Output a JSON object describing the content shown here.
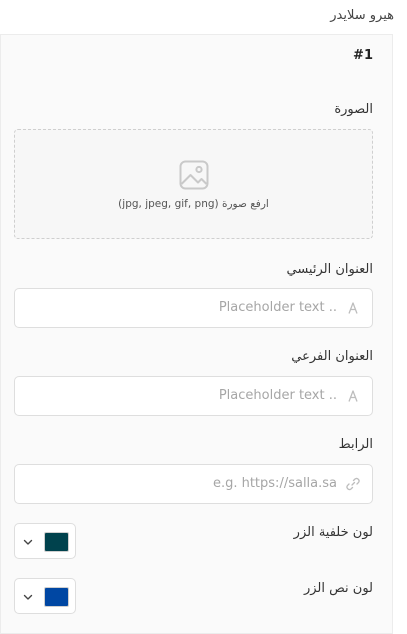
{
  "header": {
    "title": "هيرو سلايدر"
  },
  "item": {
    "number": "#1",
    "image_label": "الصورة",
    "upload_text": "ارفع صورة (jpg, jpeg, gif, png)",
    "main_title_label": "العنوان الرئيسي",
    "main_title_placeholder": "Placeholder text ..",
    "subtitle_label": "العنوان الفرعي",
    "subtitle_placeholder": "Placeholder text ..",
    "link_label": "الرابط",
    "link_placeholder": "e.g. https://salla.sa",
    "button_bg_label": "لون خلفية الزر",
    "button_bg_color": "#00424d",
    "button_text_label": "لون نص الزر",
    "button_text_color": "#0047a3"
  }
}
